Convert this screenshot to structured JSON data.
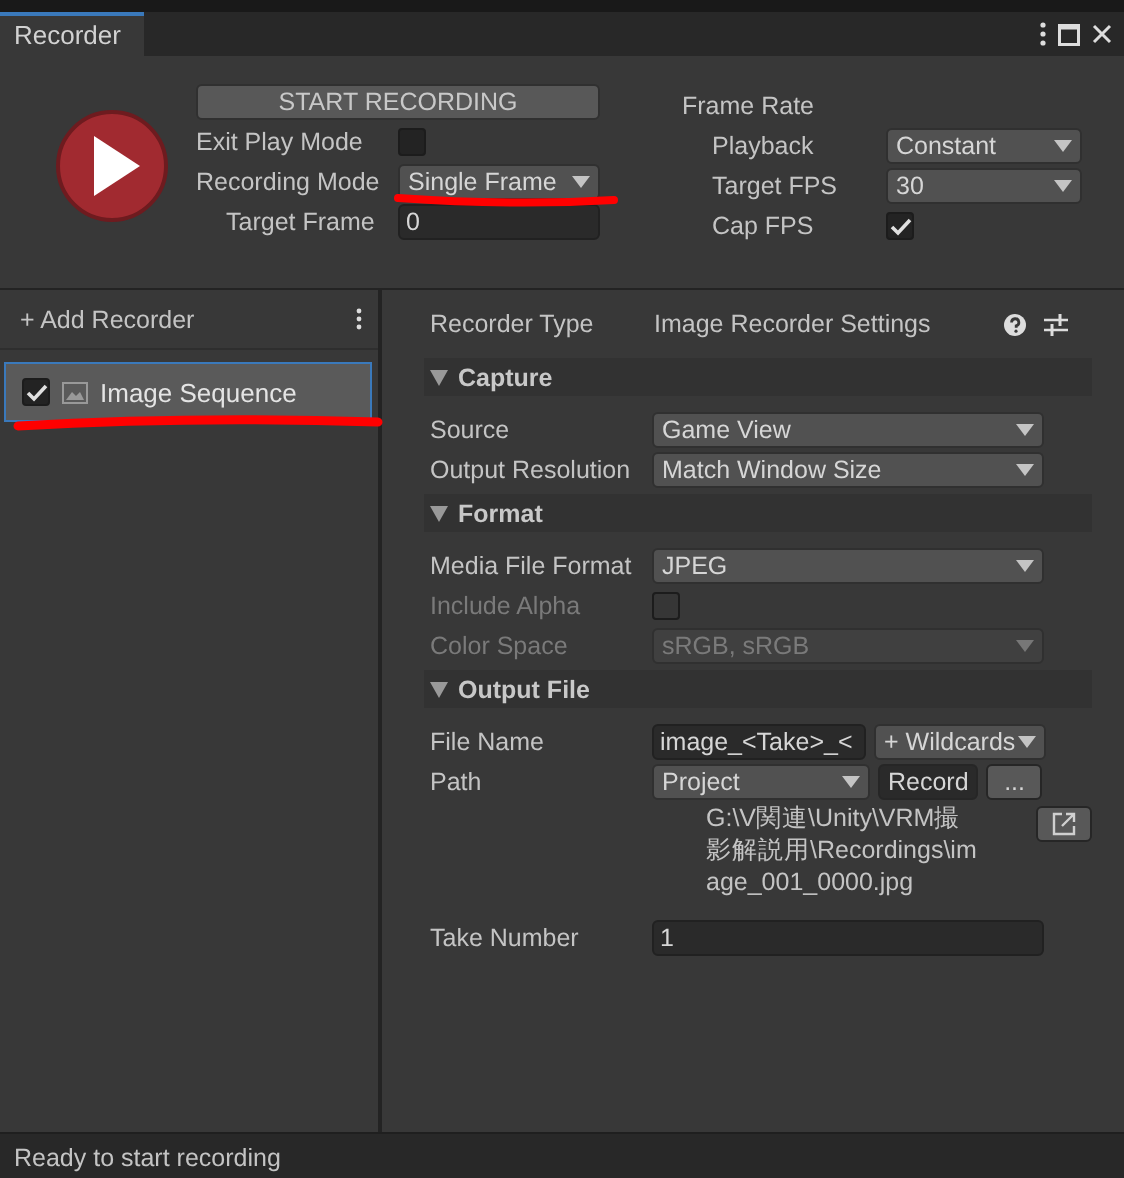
{
  "window": {
    "title": "Recorder"
  },
  "controls": {
    "start_button": "START RECORDING",
    "rows": [
      {
        "kind": "checkbox",
        "label": "Exit Play Mode",
        "checked": false,
        "indent": false
      },
      {
        "kind": "dropdown",
        "label": "Recording Mode",
        "value": "Single Frame",
        "indent": false
      },
      {
        "kind": "field",
        "label": "Target Frame",
        "value": "0",
        "indent": true
      }
    ]
  },
  "frame_rate": {
    "title": "Frame Rate",
    "rows": [
      {
        "kind": "dropdown",
        "label": "Playback",
        "value": "Constant"
      },
      {
        "kind": "dropdown",
        "label": "Target FPS",
        "value": "30"
      },
      {
        "kind": "checkbox",
        "label": "Cap FPS",
        "checked": true
      }
    ]
  },
  "recorder_list": {
    "add_label": "+ Add Recorder",
    "items": [
      {
        "label": "Image Sequence",
        "enabled": true,
        "selected": true
      }
    ]
  },
  "settings": {
    "recorder_type": {
      "label": "Recorder Type",
      "value": "Image Recorder Settings"
    },
    "sections": [
      {
        "title": "Capture",
        "expanded": true,
        "rows": [
          {
            "kind": "dropdown",
            "label": "Source",
            "value": "Game View",
            "disabled": false
          },
          {
            "kind": "dropdown",
            "label": "Output Resolution",
            "value": "Match Window Size",
            "disabled": false
          }
        ]
      },
      {
        "title": "Format",
        "expanded": true,
        "rows": [
          {
            "kind": "dropdown",
            "label": "Media File Format",
            "value": "JPEG",
            "disabled": false
          },
          {
            "kind": "checkbox",
            "label": "Include Alpha",
            "checked": false,
            "disabled": true
          },
          {
            "kind": "dropdown",
            "label": "Color Space",
            "value": "sRGB, sRGB",
            "disabled": true
          }
        ]
      },
      {
        "title": "Output File",
        "expanded": true,
        "rows": [
          {
            "kind": "filename",
            "label": "File Name",
            "value": "image_<Take>_<",
            "menu": "+ Wildcards",
            "disabled": false
          },
          {
            "kind": "path",
            "label": "Path",
            "value": "Project",
            "button": "Record",
            "browse": "...",
            "resolved": "G:\\V関連\\Unity\\VRM撮影解説用\\Recordings\\image_001_0000.jpg",
            "disabled": false
          },
          {
            "kind": "field",
            "label": "Take Number",
            "value": "1",
            "disabled": false
          }
        ]
      }
    ]
  },
  "status_bar": "Ready to start recording"
}
